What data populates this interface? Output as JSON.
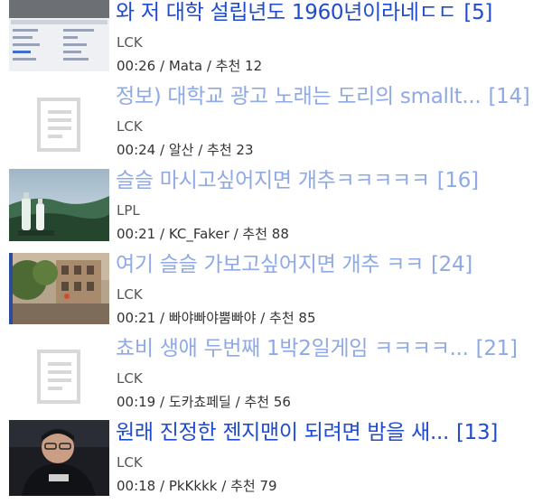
{
  "posts": [
    {
      "title": "와 저 대학 설립년도 1960년이라네ㄷㄷ",
      "comments": "[5]",
      "board": "LCK",
      "time": "00:26",
      "author": "Mata",
      "recommend_label": "추천",
      "recommend": "12",
      "thumb": "screenshot",
      "read": false
    },
    {
      "title": "정보) 대학교 광고 노래는 도리의 smallt...",
      "comments": "[14]",
      "board": "LCK",
      "time": "00:24",
      "author": "알산",
      "recommend_label": "추천",
      "recommend": "23",
      "thumb": "placeholder",
      "read": true
    },
    {
      "title": "슬슬 마시고싶어지면 개추ㅋㅋㅋㅋㅋ",
      "comments": "[16]",
      "board": "LPL",
      "time": "00:21",
      "author": "KC_Faker",
      "recommend_label": "추천",
      "recommend": "88",
      "thumb": "bottles",
      "read": true
    },
    {
      "title": "여기 슬슬 가보고싶어지면 개추 ㅋㅋ",
      "comments": "[24]",
      "board": "LCK",
      "time": "00:21",
      "author": "빠야빠야뿜빠야",
      "recommend_label": "추천",
      "recommend": "85",
      "thumb": "campus",
      "read": true
    },
    {
      "title": "쵸비 생애 두번째 1박2일게임 ㅋㅋㅋㅋ...",
      "comments": "[21]",
      "board": "LCK",
      "time": "00:19",
      "author": "도카쵸페딜",
      "recommend_label": "추천",
      "recommend": "56",
      "thumb": "placeholder",
      "read": true
    },
    {
      "title": "원래 진정한 젠지맨이 되려면 밤을 새...",
      "comments": "[13]",
      "board": "LCK",
      "time": "00:18",
      "author": "PkKkkk",
      "recommend_label": "추천",
      "recommend": "79",
      "thumb": "player",
      "read": false
    }
  ],
  "colors": {
    "read_title": "#8ea9e6",
    "unread_title": "#1f4bcf"
  }
}
